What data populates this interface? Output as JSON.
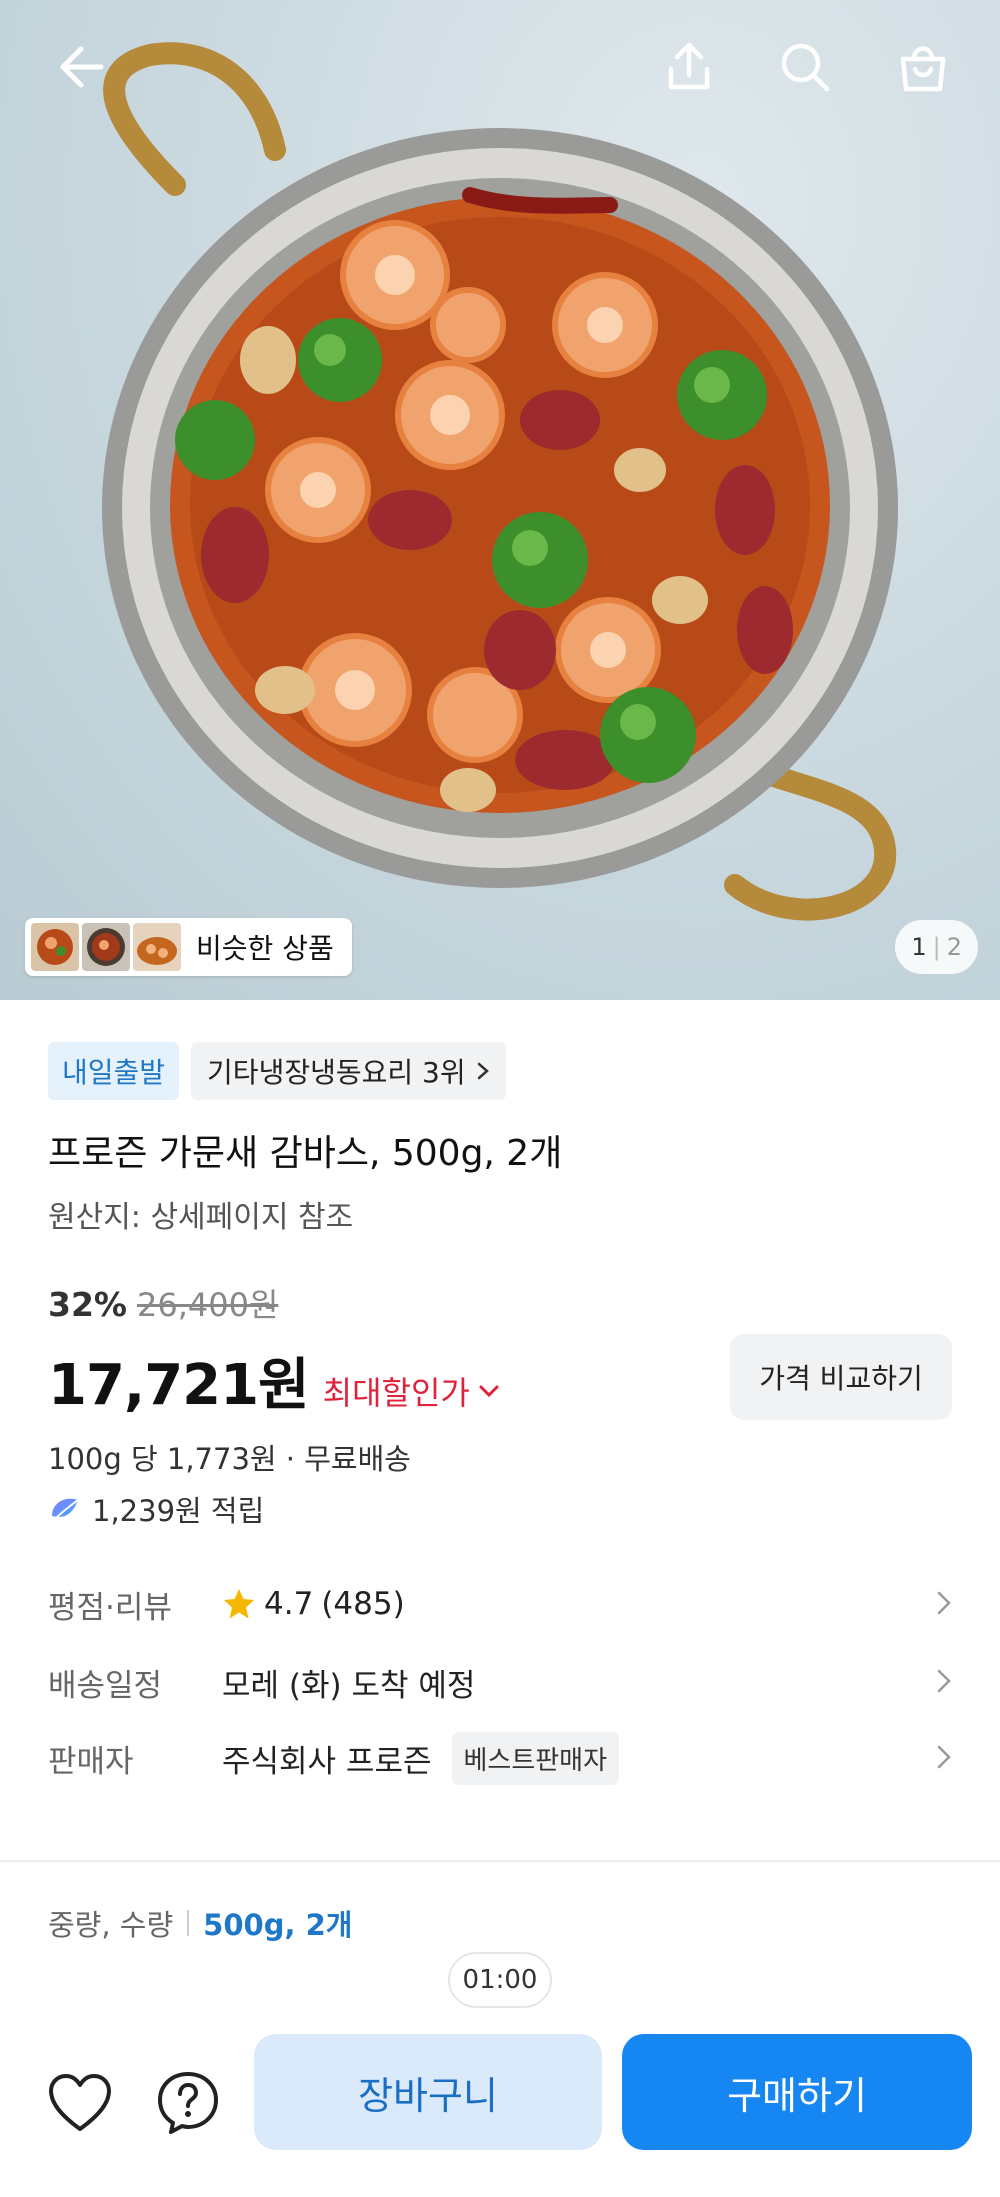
{
  "hero": {
    "similar_label": "비슷한 상품",
    "pager": {
      "current": "1",
      "total": "2"
    }
  },
  "badges": {
    "delivery": "내일출발",
    "ranking": "기타냉장냉동요리 3위"
  },
  "product": {
    "title": "프로즌 가문새 감바스, 500g, 2개",
    "origin": "원산지: 상세페이지 참조",
    "discount_rate": "32%",
    "original_price": "26,400원",
    "price": "17,721원",
    "max_discount_label": "최대할인가",
    "compare_label": "가격 비교하기",
    "unit_price": "100g 당 1,773원 · 무료배송",
    "reward": "1,239원 적립"
  },
  "details": {
    "rating_label": "평점·리뷰",
    "rating_value": "4.7",
    "review_count": "(485)",
    "shipping_label": "배송일정",
    "shipping_value": "모레 (화) 도착 예정",
    "seller_label": "판매자",
    "seller_value": "주식회사 프로즌",
    "seller_tag": "베스트판매자"
  },
  "option": {
    "label": "중량, 수량",
    "value": "500g, 2개"
  },
  "timer": "01:00",
  "actions": {
    "cart_label": "장바구니",
    "buy_label": "구매하기"
  },
  "colors": {
    "accent_blue": "#1687f2",
    "discount_red": "#e0223c",
    "star_yellow": "#f5b800"
  }
}
